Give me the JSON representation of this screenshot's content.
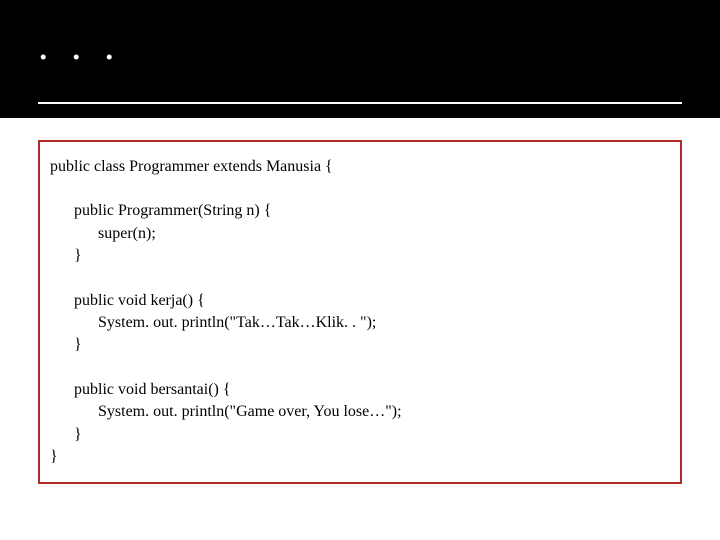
{
  "header": {
    "title": ". . ."
  },
  "code": {
    "l1": "public class Programmer extends Manusia {",
    "l2": "public Programmer(String n) {",
    "l3": "super(n);",
    "l4": "}",
    "l5": "public void kerja() {",
    "l6": "System. out. println(\"Tak…Tak…Klik. . \");",
    "l7": "}",
    "l8": "public void bersantai() {",
    "l9": "System. out. println(\"Game over, You lose…\");",
    "l10": "}",
    "l11": "}"
  }
}
